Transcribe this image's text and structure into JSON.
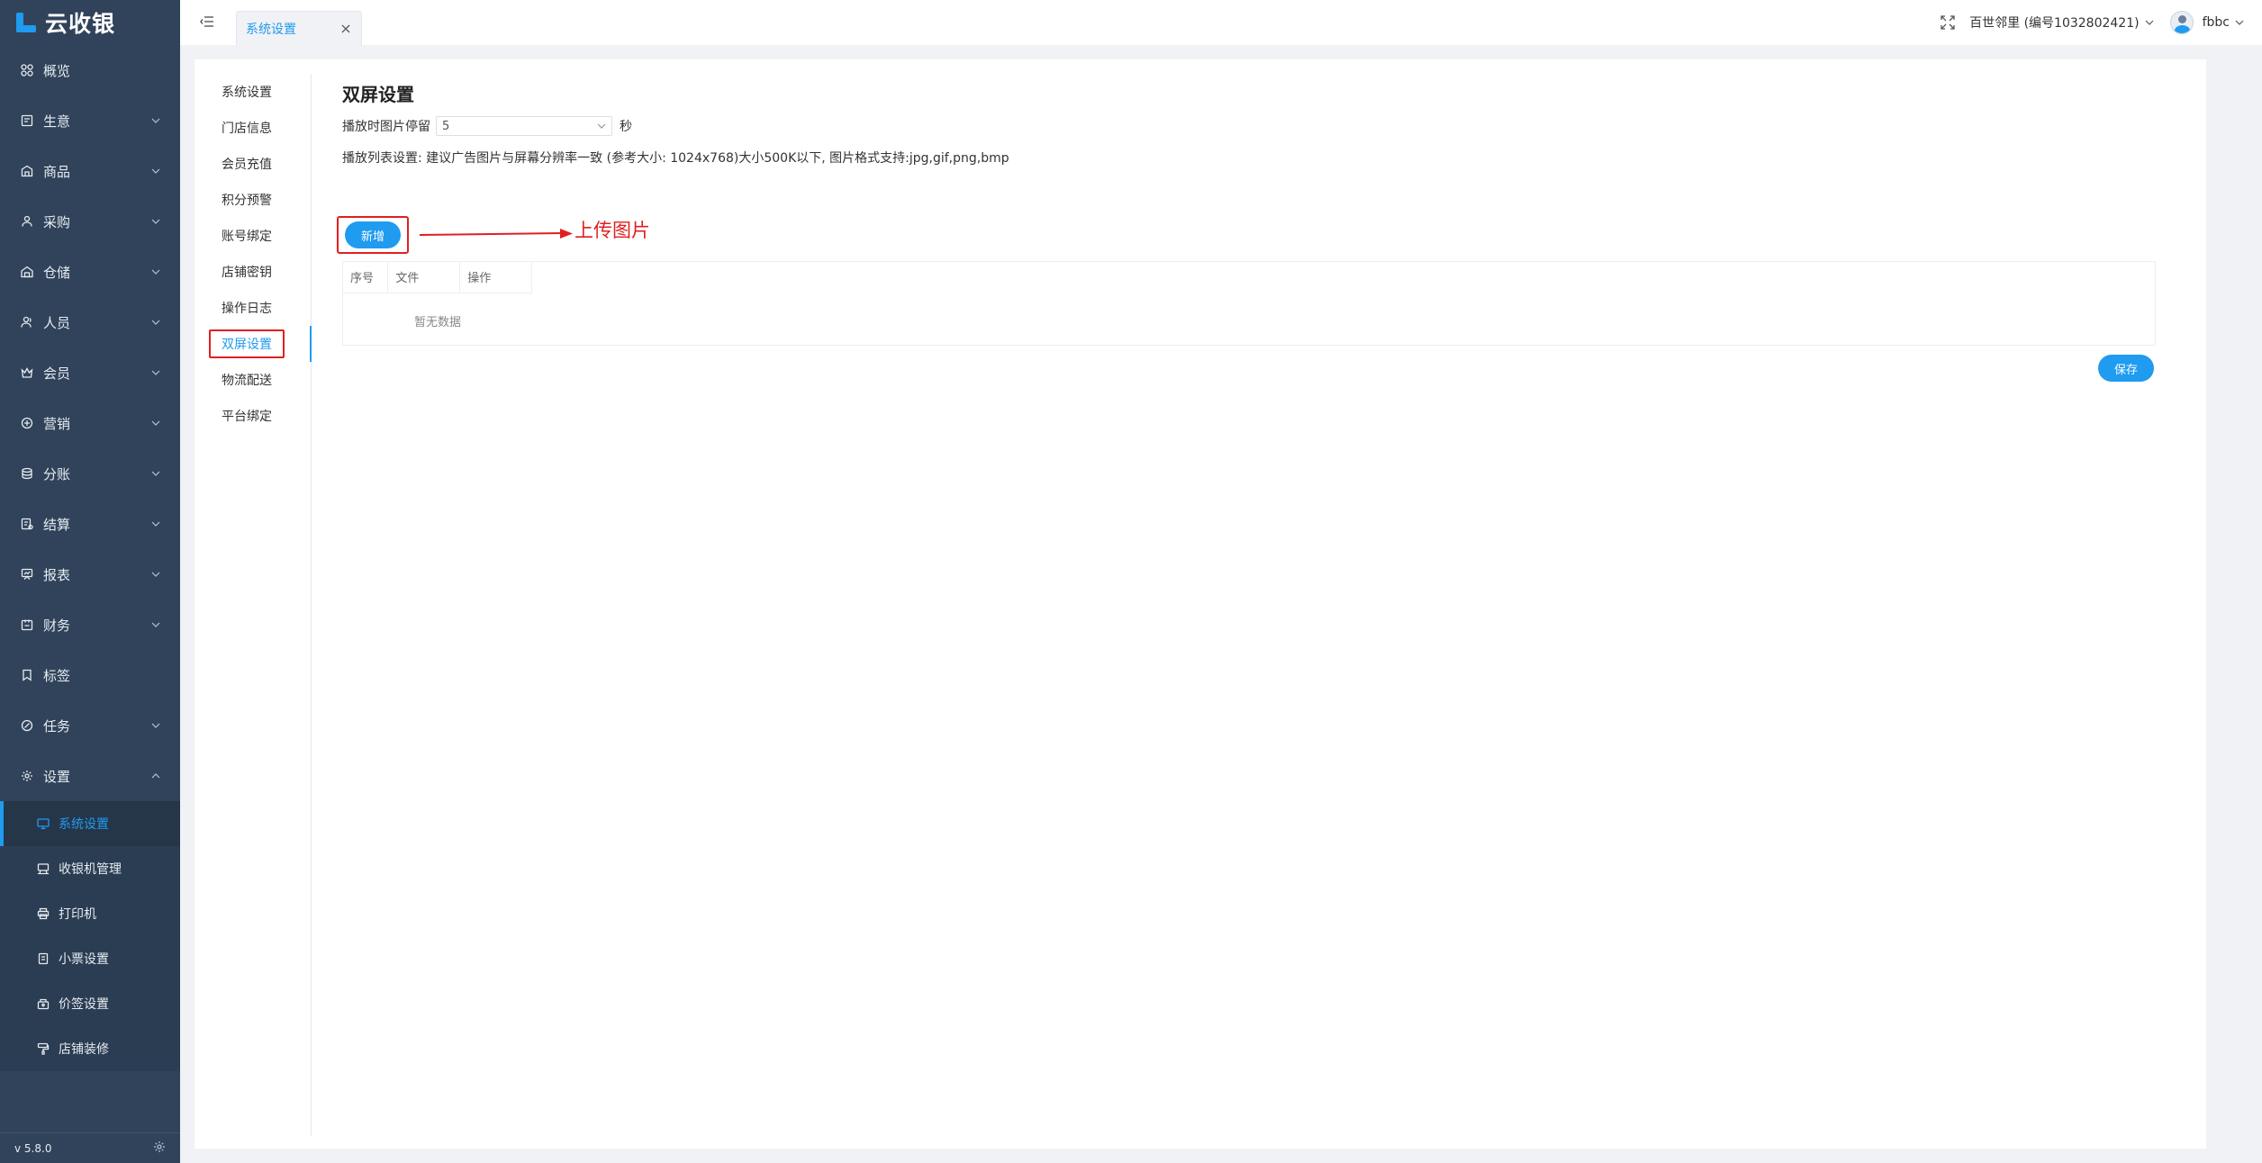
{
  "app": {
    "logo_text": "云收银",
    "version": "v 5.8.0"
  },
  "colors": {
    "accent": "#1f9bf0",
    "sidebar_bg": "#30435a",
    "annotation": "#e02020"
  },
  "sidebar": {
    "items": [
      {
        "label": "概览",
        "icon": "dashboard-icon",
        "has_arrow": false
      },
      {
        "label": "生意",
        "icon": "business-icon",
        "has_arrow": true
      },
      {
        "label": "商品",
        "icon": "goods-icon",
        "has_arrow": true
      },
      {
        "label": "采购",
        "icon": "purchase-icon",
        "has_arrow": true
      },
      {
        "label": "仓储",
        "icon": "warehouse-icon",
        "has_arrow": true
      },
      {
        "label": "人员",
        "icon": "staff-icon",
        "has_arrow": true
      },
      {
        "label": "会员",
        "icon": "member-icon",
        "has_arrow": true
      },
      {
        "label": "营销",
        "icon": "marketing-icon",
        "has_arrow": true
      },
      {
        "label": "分账",
        "icon": "split-account-icon",
        "has_arrow": true
      },
      {
        "label": "结算",
        "icon": "settlement-icon",
        "has_arrow": true
      },
      {
        "label": "报表",
        "icon": "report-icon",
        "has_arrow": true
      },
      {
        "label": "财务",
        "icon": "finance-icon",
        "has_arrow": true
      },
      {
        "label": "标签",
        "icon": "tag-icon",
        "has_arrow": false
      },
      {
        "label": "任务",
        "icon": "task-icon",
        "has_arrow": true
      },
      {
        "label": "设置",
        "icon": "settings-icon",
        "has_arrow": true,
        "expanded": true
      }
    ],
    "settings_sub": [
      {
        "label": "系统设置",
        "icon": "monitor-icon",
        "active": true
      },
      {
        "label": "收银机管理",
        "icon": "cash-register-icon"
      },
      {
        "label": "打印机",
        "icon": "printer-icon"
      },
      {
        "label": "小票设置",
        "icon": "receipt-icon"
      },
      {
        "label": "价签设置",
        "icon": "price-tag-icon"
      },
      {
        "label": "店铺装修",
        "icon": "paint-roller-icon"
      }
    ]
  },
  "header": {
    "tab_label": "系统设置",
    "store": "百世邻里 (编号1032802421)",
    "user": "fbbc"
  },
  "settings_nav": [
    "系统设置",
    "门店信息",
    "会员充值",
    "积分预警",
    "账号绑定",
    "店铺密钥",
    "操作日志",
    "双屏设置",
    "物流配送",
    "平台绑定"
  ],
  "settings_nav_active": 7,
  "main": {
    "title": "双屏设置",
    "dwell_label": "播放时图片停留",
    "dwell_value": "5",
    "dwell_unit": "秒",
    "hint": "播放列表设置: 建议广告图片与屏幕分辨率一致 (参考大小: 1024x768)大小500K以下, 图片格式支持:jpg,gif,png,bmp",
    "add_button": "新增",
    "annotation": "上传图片",
    "table": {
      "headers": [
        "序号",
        "文件",
        "操作"
      ],
      "empty_text": "暂无数据"
    },
    "save_button": "保存"
  }
}
